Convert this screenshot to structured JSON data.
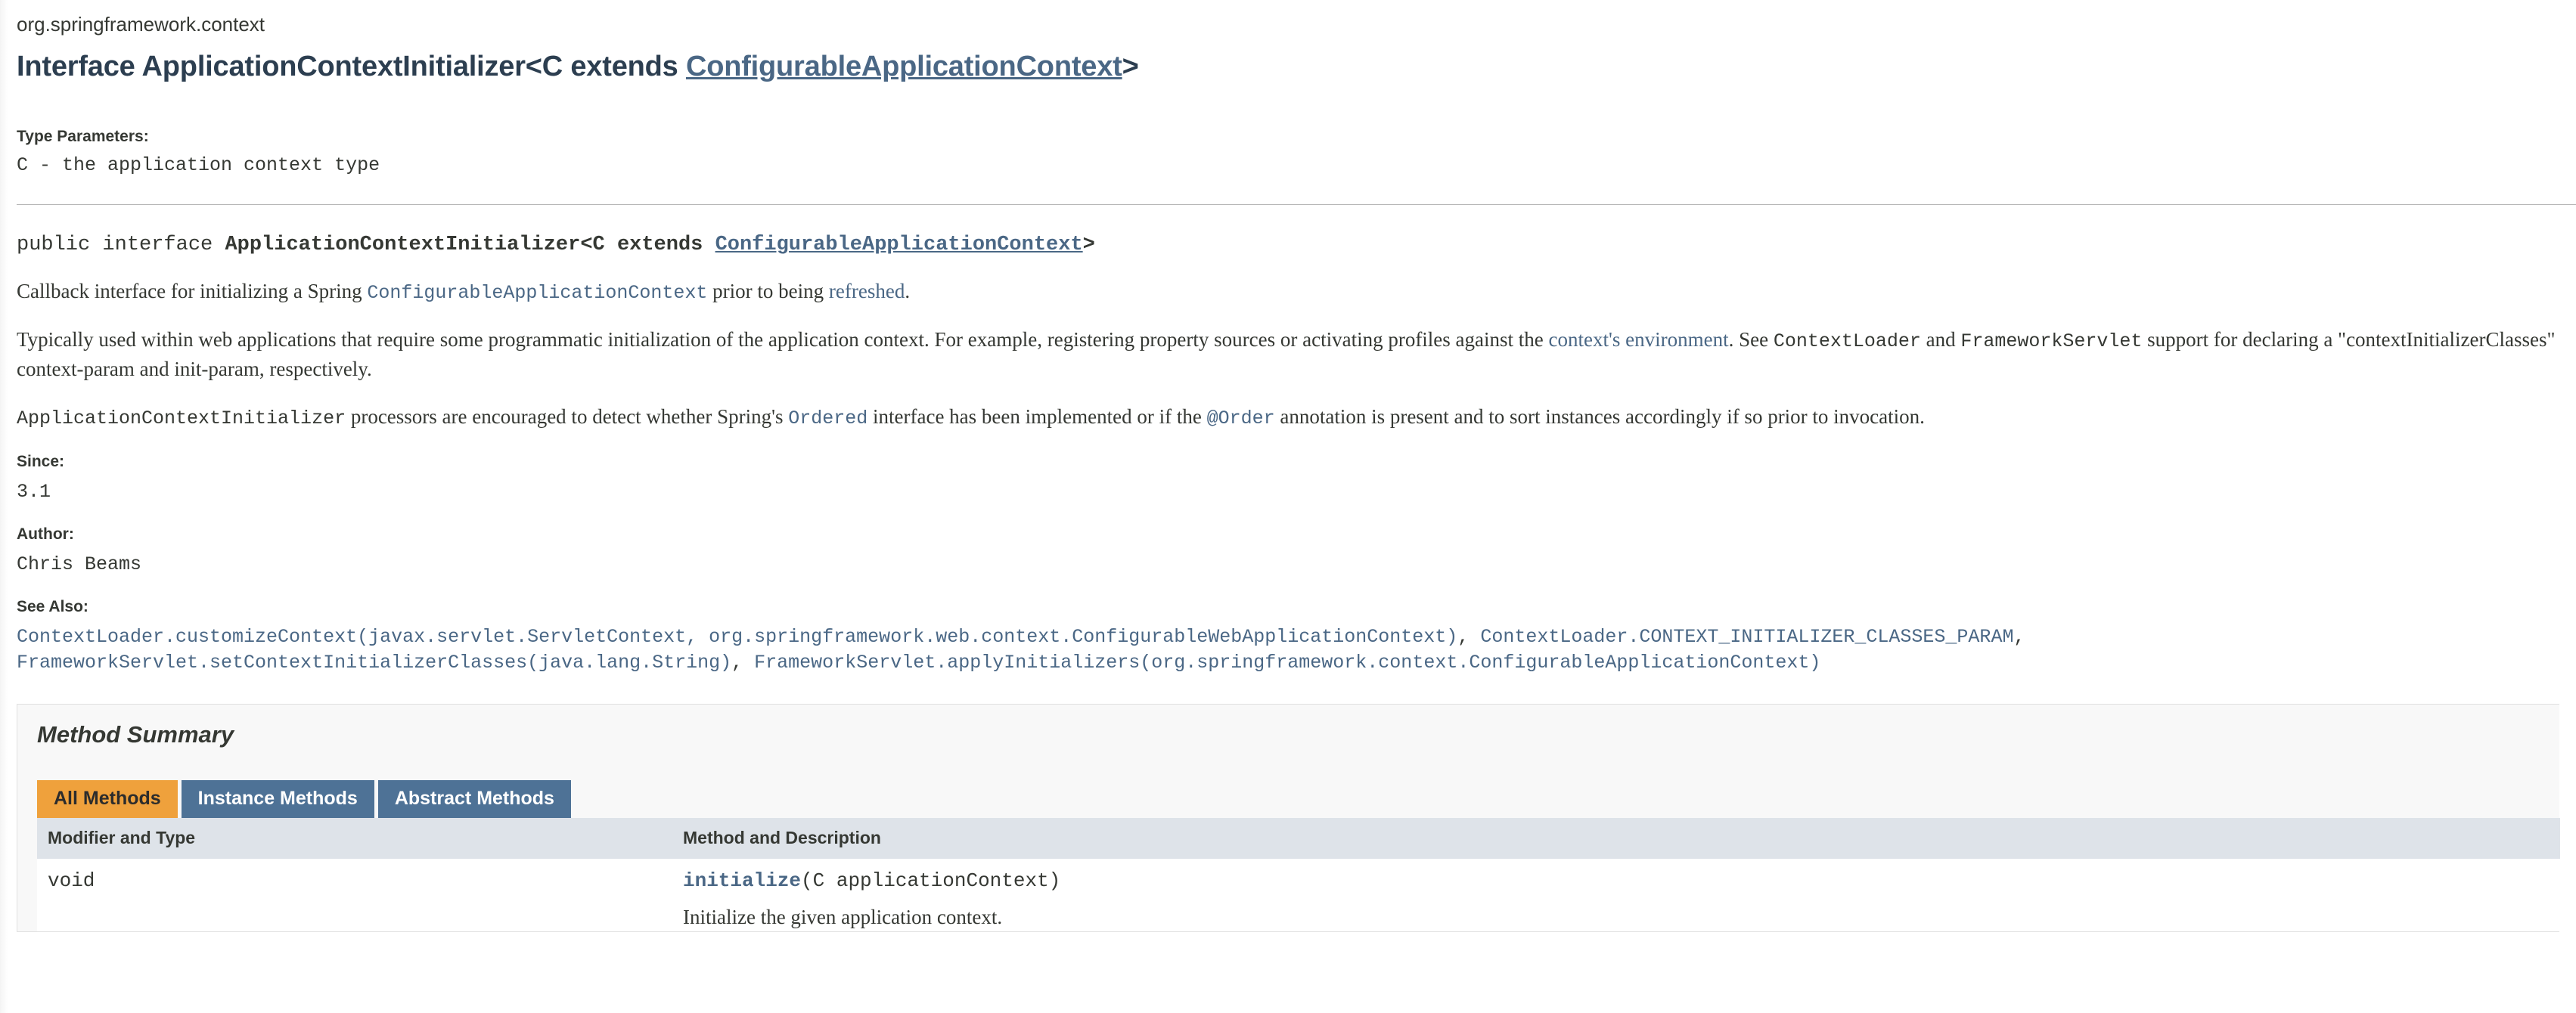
{
  "header": {
    "package": "org.springframework.context",
    "title_prefix": "Interface ApplicationContextInitializer<C extends ",
    "title_link": "ConfigurableApplicationContext",
    "title_suffix": ">"
  },
  "type_parameters": {
    "label": "Type Parameters:",
    "entry": "C - the application context type"
  },
  "signature": {
    "modifiers": "public interface ",
    "name": "ApplicationContextInitializer<C extends ",
    "bound_link": "ConfigurableApplicationContext",
    "close": ">"
  },
  "description": {
    "p1_a": "Callback interface for initializing a Spring ",
    "p1_code_link": "ConfigurableApplicationContext",
    "p1_b": " prior to being ",
    "p1_link": "refreshed",
    "p1_c": ".",
    "p2_a": "Typically used within web applications that require some programmatic initialization of the application context. For example, registering property sources or activating profiles against the ",
    "p2_link": "context's environment",
    "p2_b": ". See ",
    "p2_code1": "ContextLoader",
    "p2_c": " and ",
    "p2_code2": "FrameworkServlet",
    "p2_d": " support for declaring a \"contextInitializerClasses\" context-param and init-param, respectively.",
    "p3_code1": "ApplicationContextInitializer",
    "p3_a": " processors are encouraged to detect whether Spring's ",
    "p3_link": "Ordered",
    "p3_b": " interface has been implemented or if the ",
    "p3_code2": "@Order",
    "p3_c": " annotation is present and to sort instances accordingly if so prior to invocation."
  },
  "since": {
    "label": "Since:",
    "value": "3.1"
  },
  "author": {
    "label": "Author:",
    "value": "Chris Beams"
  },
  "see_also": {
    "label": "See Also:",
    "links": [
      "ContextLoader.customizeContext(javax.servlet.ServletContext, org.springframework.web.context.ConfigurableWebApplicationContext)",
      "ContextLoader.CONTEXT_INITIALIZER_CLASSES_PARAM",
      "FrameworkServlet.setContextInitializerClasses(java.lang.String)",
      "FrameworkServlet.applyInitializers(org.springframework.context.ConfigurableApplicationContext)"
    ],
    "line1": "ContextLoader.customizeContext(javax.servlet.ServletContext, org.springframework.web.context.ConfigurableWebApplicationContext)",
    "line1_sep": ", ",
    "line1b": "ContextLoader.CONTEXT_INITIALIZER_CLASSES_PARAM",
    "line1b_sep": ",",
    "line2": "FrameworkServlet.setContextInitializerClasses(java.lang.String)",
    "line2_sep": ", ",
    "line2b": "FrameworkServlet.applyInitializers(org.springframework.context.ConfigurableApplicationContext)"
  },
  "method_summary": {
    "title": "Method Summary",
    "tabs": [
      {
        "label": "All Methods",
        "active": true
      },
      {
        "label": "Instance Methods",
        "active": false
      },
      {
        "label": "Abstract Methods",
        "active": false
      }
    ],
    "columns": {
      "first": "Modifier and Type",
      "last": "Method and Description"
    },
    "rows": [
      {
        "modifier": "void",
        "method_name": "initialize",
        "method_params": "(C applicationContext)",
        "description": "Initialize the given application context."
      }
    ]
  },
  "colors": {
    "tab_active_bg": "#efa13c",
    "tab_inactive_bg": "#4e7296",
    "link": "#4a6785",
    "title": "#2c3e50",
    "table_header_bg": "#dee3e9",
    "panel_bg": "#f8f8f8",
    "text": "#353833"
  }
}
